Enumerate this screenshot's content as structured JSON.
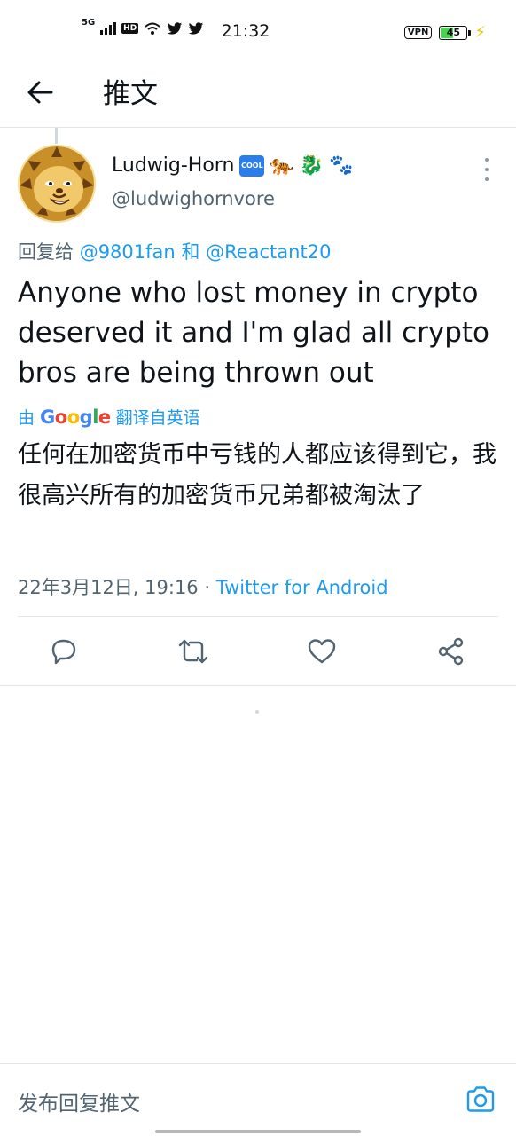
{
  "status_bar": {
    "network": "5G",
    "hd": "HD",
    "time": "21:32",
    "vpn": "VPN",
    "battery": "45"
  },
  "header": {
    "title": "推文"
  },
  "tweet": {
    "display_name": "Ludwig-Horn",
    "badge_text": "COOL",
    "name_emojis": [
      "🐅",
      "🐉",
      "🐾"
    ],
    "handle": "@ludwighornvore",
    "reply_prefix": "回复给",
    "reply_user1": "@9801fan",
    "reply_and": "和",
    "reply_user2": "@Reactant20",
    "text": "Anyone who lost money in crypto deserved it and I'm glad all crypto bros are being thrown out",
    "translate_by": "由",
    "translate_brand": "Google",
    "translate_label": "翻译自英语",
    "translated_text": "任何在加密货币中亏钱的人都应该得到它，我很高兴所有的加密货币兄弟都被淘汰了",
    "timestamp": "22年3月12日, 19:16",
    "separator": "·",
    "source": "Twitter for Android"
  },
  "compose": {
    "placeholder": "发布回复推文"
  },
  "colors": {
    "accent": "#1d9bf0",
    "text": "#0f1419",
    "secondary": "#536471"
  },
  "icons": {
    "back": "arrow-left-icon",
    "more": "more-vertical-icon",
    "reply": "reply-icon",
    "retweet": "retweet-icon",
    "like": "heart-icon",
    "share": "share-icon",
    "camera": "camera-icon"
  }
}
